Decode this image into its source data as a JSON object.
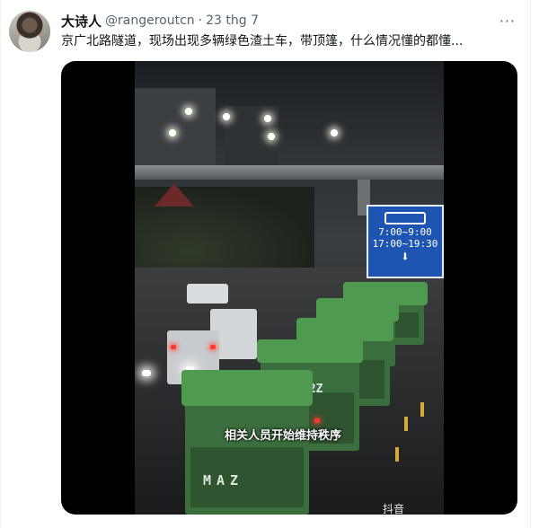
{
  "tweet": {
    "display_name": "大诗人",
    "handle": "@rangeroutcn",
    "separator": "·",
    "time": "23 thg 7",
    "more_glyph": "···",
    "text": "京广北路隧道，现场出现多辆绿色渣土车，带顶篷，什么情况懂的都懂..."
  },
  "video": {
    "sign": {
      "line1": "7:00~9:00",
      "line2": "17:00~19:30",
      "arrow": "⬇"
    },
    "truck_plate": "MAZ",
    "truck_number": "32Z",
    "caption": "相关人员开始维持秩序",
    "watermark": "抖音"
  },
  "colors": {
    "name": "#0f1419",
    "secondary_text": "#536471",
    "truck_green": "#4e9a4f",
    "sign_blue": "#1e55b3"
  }
}
